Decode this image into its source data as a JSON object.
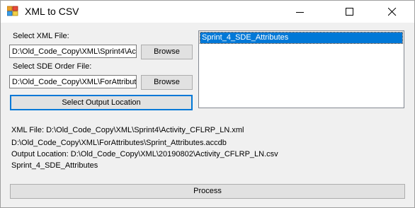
{
  "window": {
    "title": "XML to CSV"
  },
  "form": {
    "xml_label": "Select XML File:",
    "xml_path": "D:\\Old_Code_Copy\\XML\\Sprint4\\Activity_CFLRP_LN.xml",
    "sde_label": "Select SDE Order File:",
    "sde_path": "D:\\Old_Code_Copy\\XML\\ForAttributes\\Sprint_Attributes.accdb",
    "browse_label": "Browse",
    "output_button": "Select Output Location",
    "process_button": "Process"
  },
  "list": {
    "items": [
      "Sprint_4_SDE_Attributes"
    ]
  },
  "info": {
    "xml_file": "XML File: D:\\Old_Code_Copy\\XML\\Sprint4\\Activity_CFLRP_LN.xml",
    "sde_file": "D:\\Old_Code_Copy\\XML\\ForAttributes\\Sprint_Attributes.accdb",
    "output_location": "Output Location: D:\\Old_Code_Copy\\XML\\20190802\\Activity_CFLRP_LN.csv",
    "table": "Sprint_4_SDE_Attributes"
  }
}
